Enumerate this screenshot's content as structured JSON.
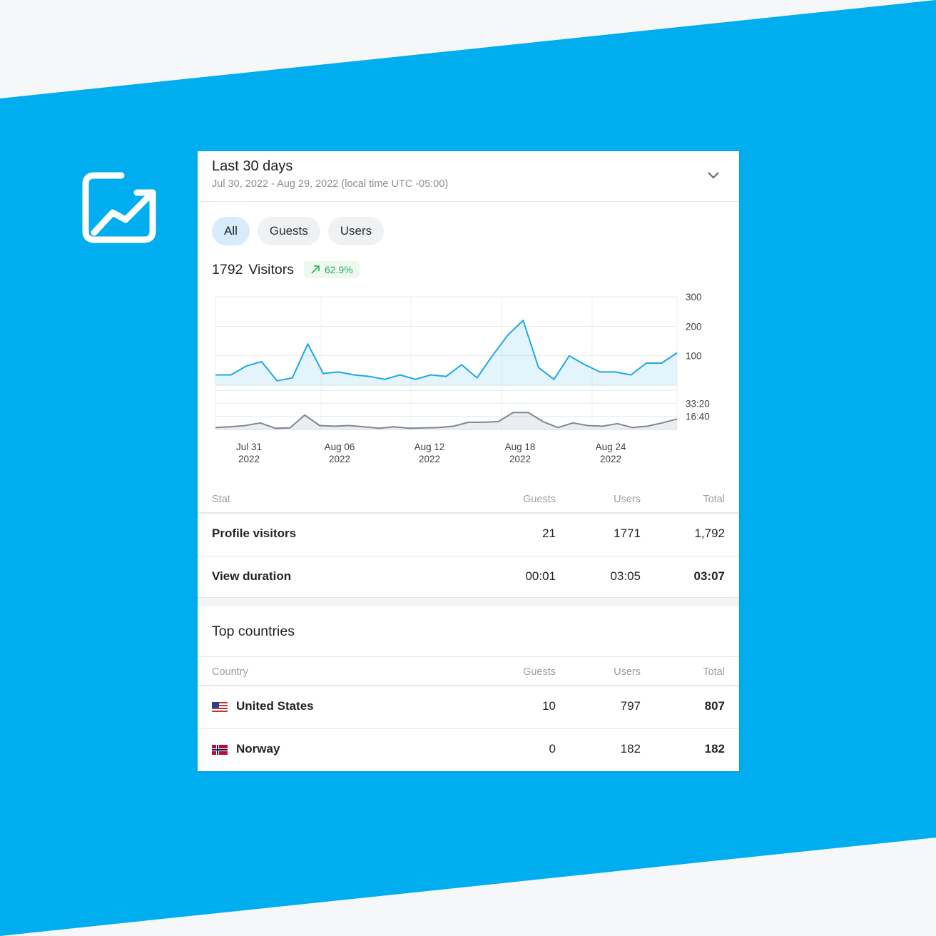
{
  "header": {
    "title": "Last 30 days",
    "subtitle": "Jul 30, 2022 - Aug 29, 2022 (local time UTC -05:00)"
  },
  "filters": [
    {
      "label": "All",
      "active": true
    },
    {
      "label": "Guests",
      "active": false
    },
    {
      "label": "Users",
      "active": false
    }
  ],
  "visitors": {
    "count": "1792",
    "label": "Visitors",
    "trend": "62.9%",
    "trend_color": "#27ae60"
  },
  "colors": {
    "accent": "#1fa7e6",
    "secondary_series": "#7d8794",
    "background": "#00aeef"
  },
  "chart_data": {
    "type": "area",
    "x_tick_labels": [
      {
        "line1": "Jul 31",
        "line2": "2022"
      },
      {
        "line1": "Aug 06",
        "line2": "2022"
      },
      {
        "line1": "Aug 12",
        "line2": "2022"
      },
      {
        "line1": "Aug 18",
        "line2": "2022"
      },
      {
        "line1": "Aug 24",
        "line2": "2022"
      }
    ],
    "panels": [
      {
        "name": "visitors",
        "ylim": [
          0,
          300
        ],
        "y_ticks": [
          100,
          200,
          300
        ],
        "y_tick_labels": [
          "100",
          "200",
          "300"
        ],
        "values": [
          35,
          35,
          65,
          80,
          15,
          25,
          140,
          40,
          45,
          35,
          30,
          20,
          35,
          20,
          35,
          30,
          70,
          25,
          100,
          170,
          220,
          60,
          20,
          100,
          70,
          45,
          45,
          35,
          75,
          75,
          110
        ]
      },
      {
        "name": "view duration",
        "ylim": [
          0,
          3000
        ],
        "y_ticks": [
          1000,
          2000
        ],
        "y_tick_labels": [
          "16:40",
          "33:20"
        ],
        "values": [
          150,
          200,
          300,
          500,
          100,
          120,
          1100,
          300,
          250,
          300,
          200,
          100,
          200,
          100,
          120,
          150,
          250,
          550,
          550,
          600,
          1300,
          1300,
          600,
          150,
          500,
          300,
          250,
          450,
          150,
          250,
          500,
          800
        ]
      }
    ],
    "grid": true
  },
  "stats_table": {
    "headers": {
      "name": "Stat",
      "guests": "Guests",
      "users": "Users",
      "total": "Total"
    },
    "rows": [
      {
        "name": "Profile visitors",
        "guests": "21",
        "users": "1771",
        "total": "1,792"
      },
      {
        "name": "View duration",
        "guests": "00:01",
        "users": "03:05",
        "total": "03:07"
      }
    ]
  },
  "countries": {
    "title": "Top countries",
    "headers": {
      "name": "Country",
      "guests": "Guests",
      "users": "Users",
      "total": "Total"
    },
    "rows": [
      {
        "flag": "us-flag-icon",
        "name": "United States",
        "guests": "10",
        "users": "797",
        "total": "807"
      },
      {
        "flag": "norway-flag-icon",
        "name": "Norway",
        "guests": "0",
        "users": "182",
        "total": "182"
      }
    ]
  }
}
